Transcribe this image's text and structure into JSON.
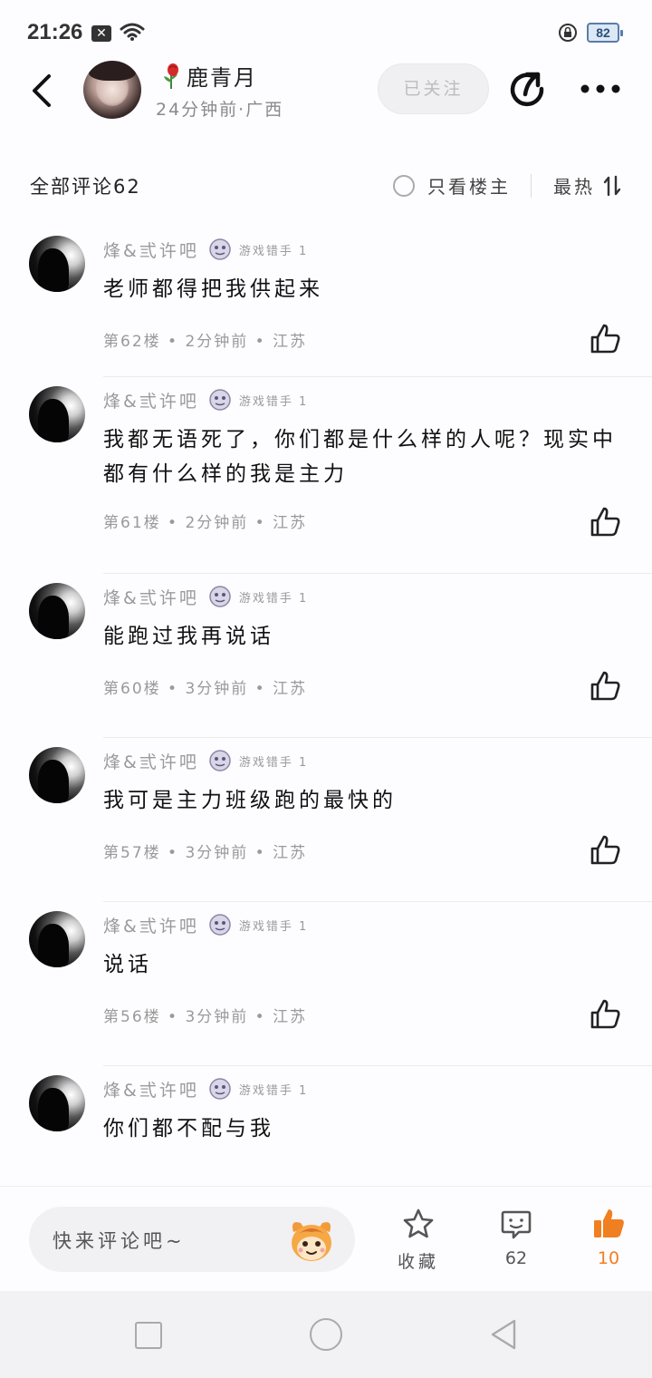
{
  "status_bar": {
    "time": "21:26",
    "battery": "82"
  },
  "header": {
    "author_name": "鹿青月",
    "author_meta": "24分钟前·广西",
    "follow_label": "已关注"
  },
  "comments_header": {
    "count_label": "全部评论62",
    "op_only_label": "只看楼主",
    "sort_label": "最热"
  },
  "comments": [
    {
      "user": "烽&弎许吧",
      "level": "游戏错手 1",
      "text": "老师都得把我供起来",
      "meta": "第62楼 • 2分钟前 • 江苏"
    },
    {
      "user": "烽&弎许吧",
      "level": "游戏错手 1",
      "text": "我都无语死了，你们都是什么样的人呢？现实中都有什么样的我是主力",
      "meta": "第61楼 • 2分钟前 • 江苏"
    },
    {
      "user": "烽&弎许吧",
      "level": "游戏错手 1",
      "text": "能跑过我再说话",
      "meta": "第60楼 • 3分钟前 • 江苏"
    },
    {
      "user": "烽&弎许吧",
      "level": "游戏错手 1",
      "text": "我可是主力班级跑的最快的",
      "meta": "第57楼 • 3分钟前 • 江苏"
    },
    {
      "user": "烽&弎许吧",
      "level": "游戏错手 1",
      "text": "说话",
      "meta": "第56楼 • 3分钟前 • 江苏"
    },
    {
      "user": "烽&弎许吧",
      "level": "游戏错手 1",
      "text": "你们都不配与我",
      "meta": ""
    }
  ],
  "action_bar": {
    "input_placeholder": "快来评论吧~",
    "favorite_label": "收藏",
    "reply_count": "62",
    "like_count": "10"
  },
  "colors": {
    "accent": "#f07f21",
    "text_secondary": "#9a9a9a",
    "background": "#fdfcfe"
  }
}
